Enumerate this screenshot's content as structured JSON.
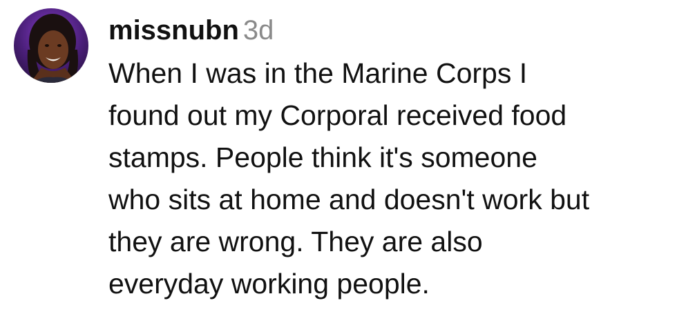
{
  "comment": {
    "username": "missnubn",
    "timestamp": "3d",
    "avatar_icon": "user-avatar-photo",
    "text_lines": [
      "When I was in the Marine Corps I",
      "found out my Corporal received food",
      "stamps. People think it's someone",
      "who sits at home and doesn't work but",
      "they are wrong. They are also",
      "everyday working people."
    ]
  },
  "colors": {
    "text": "#111111",
    "timestamp": "#8a8a8a",
    "background": "#ffffff",
    "avatar_bg": "#5a2a8a"
  }
}
